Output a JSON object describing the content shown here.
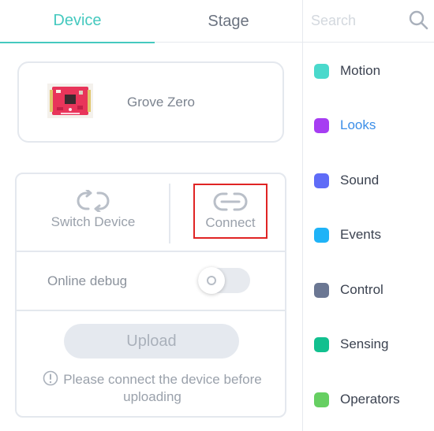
{
  "tabs": [
    {
      "label": "Device"
    },
    {
      "label": "Stage"
    }
  ],
  "device": {
    "name": "Grove Zero"
  },
  "actions": {
    "switch_label": "Switch Device",
    "connect_label": "Connect"
  },
  "debug": {
    "label": "Online debug",
    "enabled": false
  },
  "upload": {
    "label": "Upload",
    "warning": "Please connect the device before uploading"
  },
  "search": {
    "placeholder": "Search"
  },
  "categories": [
    {
      "label": "Motion",
      "color": "#4ad9cc"
    },
    {
      "label": "Looks",
      "color": "#a63df2",
      "active": true
    },
    {
      "label": "Sound",
      "color": "#5f6cf7"
    },
    {
      "label": "Events",
      "color": "#1fb3f7"
    },
    {
      "label": "Control",
      "color": "#6b7793"
    },
    {
      "label": "Sensing",
      "color": "#12c08f"
    },
    {
      "label": "Operators",
      "color": "#66cf62"
    }
  ],
  "colors": {
    "accent": "#45c9bf",
    "highlight_box": "#e02424",
    "active_category_text": "#3b8ee8"
  }
}
